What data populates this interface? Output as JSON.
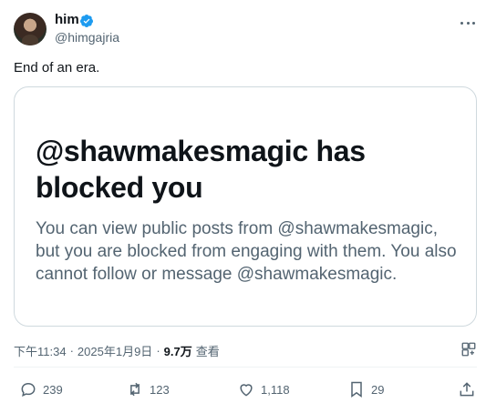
{
  "author": {
    "display_name": "him",
    "handle": "@himgajria",
    "verified_icon": "verified-badge-icon"
  },
  "tweet": {
    "text": "End of an era."
  },
  "card": {
    "title": "@shawmakesmagic has blocked you",
    "body": "You can view public posts from @shawmakesmagic, but you are blocked from engaging with them. You also cannot follow or message @shawmakesmagic."
  },
  "meta": {
    "time": "下午11:34",
    "separator": "·",
    "date": "2025年1月9日",
    "views_count": "9.7万",
    "views_label": "查看"
  },
  "actions": {
    "replies": "239",
    "reposts": "123",
    "likes": "1,118",
    "bookmarks": "29"
  },
  "colors": {
    "accent": "#1d9bf0",
    "secondary_text": "#536471",
    "primary_text": "#0f1419",
    "border": "#cfd9de"
  }
}
